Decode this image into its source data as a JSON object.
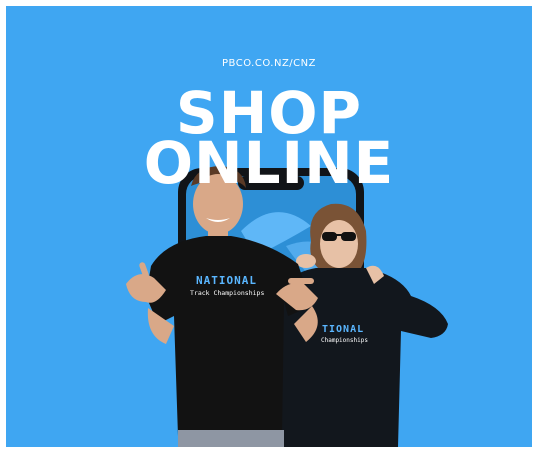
{
  "poster": {
    "url": "PBCO.CO.NZ/CNZ",
    "headline_line1": "SHOP",
    "headline_line2": "ONLINE",
    "tshirt_print_line1": "NATIONAL",
    "tshirt_print_line2": "Track Championships",
    "hoodie_print_line1": "TIONAL",
    "hoodie_print_line2": "Championships"
  },
  "colors": {
    "background": "#3fa6f2",
    "headline": "#ffffff",
    "print_accent": "#5ab6ff"
  }
}
